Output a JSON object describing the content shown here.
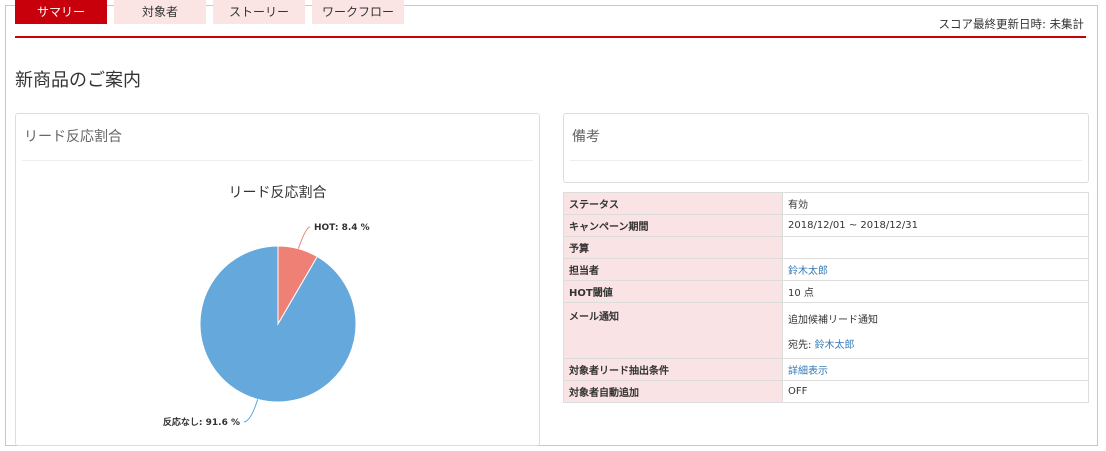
{
  "tabs": [
    {
      "label": "サマリー",
      "active": true
    },
    {
      "label": "対象者",
      "active": false
    },
    {
      "label": "ストーリー",
      "active": false
    },
    {
      "label": "ワークフロー",
      "active": false
    }
  ],
  "score_updated": "スコア最終更新日時: 未集計",
  "page_title": "新商品のご案内",
  "lead_panel": {
    "title": "リード反応割合",
    "chart_title": "リード反応割合"
  },
  "chart_data": {
    "type": "pie",
    "title": "リード反応割合",
    "slices": [
      {
        "label": "HOT: 8.4 %",
        "name": "HOT",
        "value": 8.4,
        "color": "#ef8075"
      },
      {
        "label": "反応なし: 91.6 %",
        "name": "反応なし",
        "value": 91.6,
        "color": "#64a8dc"
      }
    ]
  },
  "notes_panel": {
    "title": "備考"
  },
  "info": {
    "status_label": "ステータス",
    "status_value": "有効",
    "period_label": "キャンペーン期間",
    "period_value": "2018/12/01 ~ 2018/12/31",
    "budget_label": "予算",
    "budget_value": "",
    "owner_label": "担当者",
    "owner_value": "鈴木太郎",
    "hot_label": "HOT閾値",
    "hot_value": "10 点",
    "mail_label": "メール通知",
    "mail_value": "追加候補リード通知",
    "mail_to_prefix": "宛先:",
    "mail_to_value": "鈴木太郎",
    "extract_label": "対象者リード抽出条件",
    "extract_value": "詳細表示",
    "autoadd_label": "対象者自動追加",
    "autoadd_value": "OFF"
  },
  "colors": {
    "accent": "#c8000b",
    "tab_inactive": "#fbe4e4",
    "table_key_bg": "#f9e3e5",
    "link": "#337ab7"
  }
}
